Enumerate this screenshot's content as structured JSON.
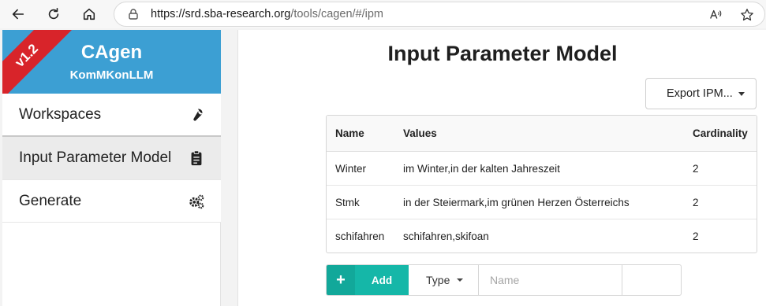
{
  "browser": {
    "url_host": "https://srd.sba-research.org",
    "url_path": "/tools/cagen/#/ipm",
    "icons": [
      "back-arrow-icon",
      "reload-icon",
      "home-icon",
      "lock-icon",
      "read-aloud-icon",
      "favorite-star-icon"
    ]
  },
  "sidebar": {
    "version": "v1.2",
    "title": "CAgen",
    "subtitle": "KomMKonLLM",
    "items": [
      {
        "label": "Workspaces",
        "icon": "wrench-icon"
      },
      {
        "label": "Input Parameter Model",
        "icon": "clipboard-icon"
      },
      {
        "label": "Generate",
        "icon": "gears-icon"
      }
    ],
    "active_index": 1
  },
  "main": {
    "title": "Input Parameter Model",
    "export_label": "Export IPM...",
    "table": {
      "headers": [
        "Name",
        "Values",
        "Cardinality"
      ],
      "rows": [
        {
          "name": "Winter",
          "values": "im Winter,in der kalten Jahreszeit",
          "cardinality": "2"
        },
        {
          "name": "Stmk",
          "values": "in der Steiermark,im grünen Herzen Österreichs",
          "cardinality": "2"
        },
        {
          "name": "schifahren",
          "values": "schifahren,skifoan",
          "cardinality": "2"
        }
      ]
    },
    "add_bar": {
      "plus": "+",
      "add_label": "Add",
      "type_label": "Type",
      "name_placeholder": "Name"
    }
  },
  "colors": {
    "brand": "#3c9fd3",
    "ribbon": "#d8242a",
    "add_green": "#15b7a8"
  }
}
